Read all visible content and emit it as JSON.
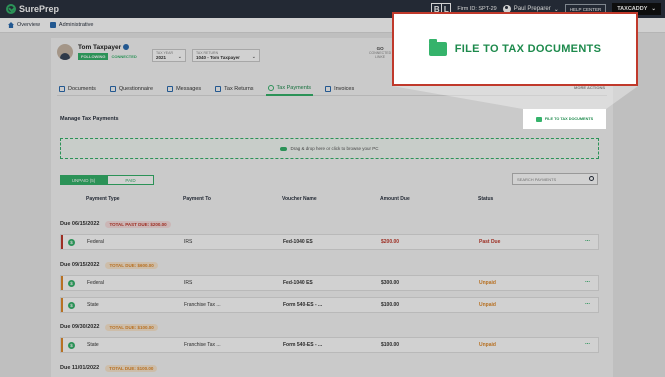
{
  "brand": {
    "name": "SurePrep"
  },
  "header": {
    "logo_letters": [
      "B",
      "L"
    ],
    "firm_id": "Firm ID: SPT-29",
    "user": "Paul Preparer",
    "help": "HELP CENTER",
    "taxcaddy": "TAXCADDY"
  },
  "subnav": {
    "overview": "Overview",
    "administrative": "Administrative"
  },
  "client": {
    "name": "Tom Taxpayer",
    "following": "FOLLOWING",
    "connected": "CONNECTED",
    "tax_year_label": "TAX YEAR",
    "tax_year": "2021",
    "tax_return_label": "TAX RETURN",
    "tax_return": "1040 - Tom Taxpayer",
    "go_label": "GO",
    "go_sub1": "CONNECTED",
    "go_sub2": "LINKE"
  },
  "tabs": [
    "Documents",
    "Questionnaire",
    "Messages",
    "Tax Returns",
    "Tax Payments",
    "Invoices"
  ],
  "active_tab": "Tax Payments",
  "more_actions": "MORE ACTIONS",
  "section_title": "Manage Tax Payments",
  "dropzone_text": "Drag & drop here or click to browse your PC",
  "toggle": {
    "unpaid": "UNPAID (5)",
    "paid": "PAID"
  },
  "search_placeholder": "SEARCH PAYMENTS",
  "columns": [
    "Payment Type",
    "Payment To",
    "Voucher Name",
    "Amount Due",
    "Status"
  ],
  "groups": [
    {
      "due": "Due 06/15/2022",
      "badge": "TOTAL PAST DUE: $200.00",
      "tone": "red",
      "rows": [
        {
          "type": "Federal",
          "to": "IRS",
          "voucher": "Fed-1040 ES",
          "amount": "$200.00",
          "status": "Past Due"
        }
      ]
    },
    {
      "due": "Due 09/15/2022",
      "badge": "TOTAL DUE: $600.00",
      "tone": "orange",
      "rows": [
        {
          "type": "Federal",
          "to": "IRS",
          "voucher": "Fed-1040 ES",
          "amount": "$300.00",
          "status": "Unpaid"
        },
        {
          "type": "State",
          "to": "Franchise Tax ...",
          "voucher": "Form 540-ES - ...",
          "amount": "$100.00",
          "status": "Unpaid"
        }
      ]
    },
    {
      "due": "Due 09/30/2022",
      "badge": "TOTAL DUE: $100.00",
      "tone": "orange",
      "rows": [
        {
          "type": "State",
          "to": "Franchise Tax ...",
          "voucher": "Form 540-ES - ...",
          "amount": "$100.00",
          "status": "Unpaid"
        }
      ]
    },
    {
      "due": "Due 11/01/2022",
      "badge": "TOTAL DUE: $100.00",
      "tone": "orange",
      "rows": []
    }
  ],
  "row_menu": "...",
  "dollar_glyph": "$",
  "file_button": "FILE TO TAX DOCUMENTS",
  "callout_text": "FILE TO TAX DOCUMENTS",
  "colors": {
    "accent": "#35b36b",
    "navy": "#2b3340",
    "danger": "#c0392b",
    "warn": "#e08a2b"
  }
}
